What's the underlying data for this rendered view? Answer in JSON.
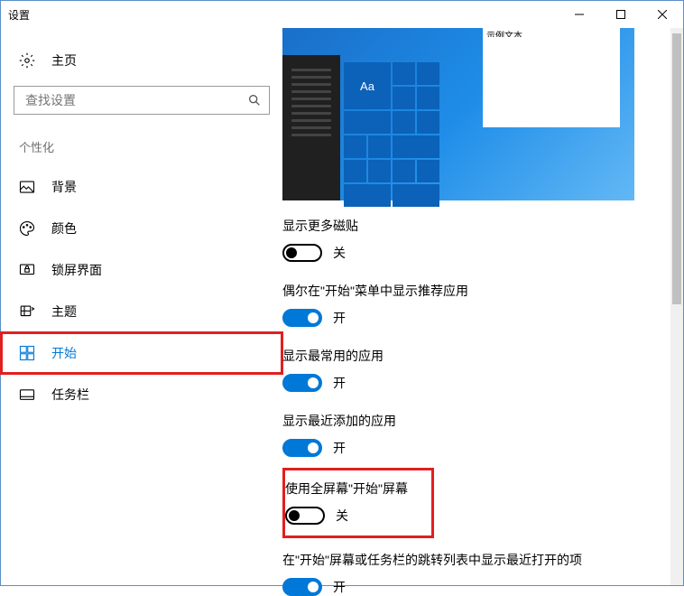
{
  "window": {
    "title": "设置"
  },
  "sidebar": {
    "home": "主页",
    "search_placeholder": "查找设置",
    "category": "个性化",
    "items": [
      {
        "label": "背景"
      },
      {
        "label": "颜色"
      },
      {
        "label": "锁屏界面"
      },
      {
        "label": "主题"
      },
      {
        "label": "开始",
        "selected": true,
        "highlighted": true
      },
      {
        "label": "任务栏"
      }
    ]
  },
  "preview": {
    "caption": "示例文本",
    "tile_text": "Aa"
  },
  "settings": [
    {
      "label": "显示更多磁贴",
      "state": "off",
      "state_text": "关"
    },
    {
      "label": "偶尔在\"开始\"菜单中显示推荐应用",
      "state": "on",
      "state_text": "开"
    },
    {
      "label": "显示最常用的应用",
      "state": "on",
      "state_text": "开"
    },
    {
      "label": "显示最近添加的应用",
      "state": "on",
      "state_text": "开"
    },
    {
      "label": "使用全屏幕\"开始\"屏幕",
      "state": "off",
      "state_text": "关",
      "highlighted": true
    },
    {
      "label": "在\"开始\"屏幕或任务栏的跳转列表中显示最近打开的项",
      "state": "on",
      "state_text": "开"
    }
  ],
  "colors": {
    "accent": "#0078d7",
    "highlight_border": "#e21f1f"
  }
}
